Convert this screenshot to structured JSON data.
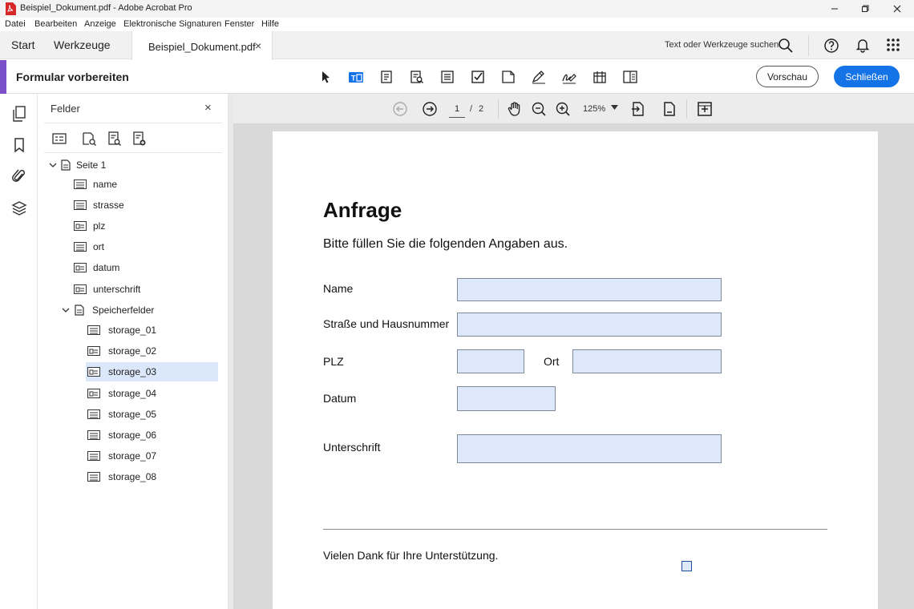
{
  "window": {
    "title": "Beispiel_Dokument.pdf - Adobe Acrobat Pro"
  },
  "menu": [
    "Datei",
    "Bearbeiten",
    "Anzeige",
    "Elektronische Signaturen",
    "Fenster",
    "Hilfe"
  ],
  "tabs": {
    "start": "Start",
    "tools": "Werkzeuge",
    "document": "Beispiel_Dokument.pdf",
    "close_glyph": "×"
  },
  "search": {
    "label": "Text oder Werkzeuge suchen"
  },
  "form_toolbar": {
    "title": "Formular vorbereiten",
    "preview_label": "Vorschau",
    "close_label": "Schließen",
    "accent_color": "#7b4fc8",
    "button_color": "#1473e6"
  },
  "fields_panel": {
    "title": "Felder",
    "close_glyph": "×",
    "tree": {
      "page": "Seite 1",
      "fields": [
        "name",
        "strasse",
        "plz",
        "ort",
        "datum",
        "unterschrift"
      ],
      "group": "Speicherfelder",
      "group_fields": [
        "storage_01",
        "storage_02",
        "storage_03",
        "storage_04",
        "storage_05",
        "storage_06",
        "storage_07",
        "storage_08"
      ],
      "selected": "storage_03"
    }
  },
  "page_nav": {
    "current_page": "1",
    "separator": "/",
    "total_pages": "2",
    "zoom": "125%"
  },
  "document": {
    "heading": "Anfrage",
    "intro": "Bitte füllen Sie die folgenden Angaben aus.",
    "labels": {
      "name": "Name",
      "street": "Straße und Hausnummer",
      "zip": "PLZ",
      "city": "Ort",
      "date": "Datum",
      "signature": "Unterschrift"
    },
    "footer": "Vielen Dank für Ihre Unterstützung."
  }
}
